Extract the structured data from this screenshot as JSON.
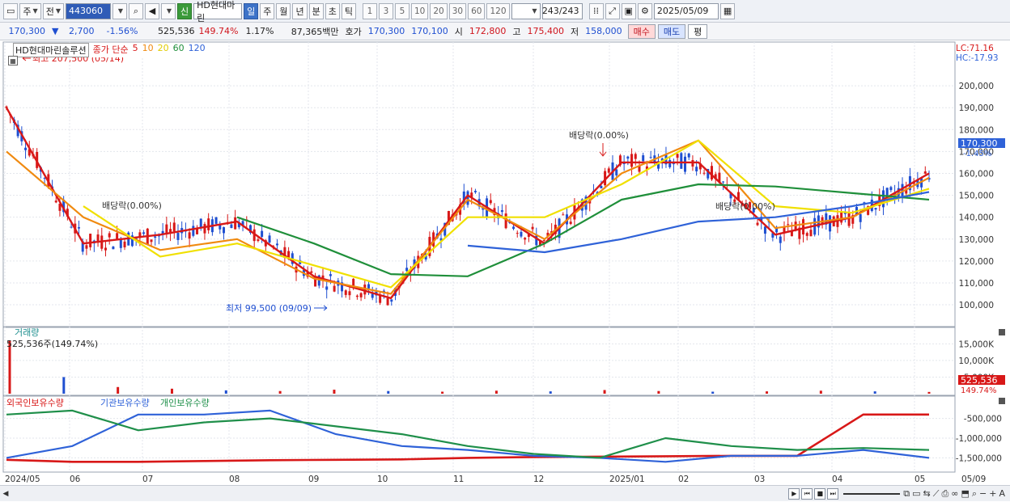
{
  "toolbar": {
    "period_label": "주",
    "prev_label": "전",
    "code": "443060",
    "new_badge": "신",
    "name": "HD현대마린",
    "intervals": [
      "일",
      "주",
      "월",
      "년",
      "분",
      "초",
      "틱"
    ],
    "active_interval": "일",
    "multipliers": [
      "1",
      "3",
      "5",
      "10",
      "20",
      "30",
      "60",
      "120"
    ],
    "count": "243",
    "count_total": "/243",
    "date": "2025/05/09"
  },
  "pricebar": {
    "price": "170,300",
    "change_arrow": "▼",
    "change": "2,700",
    "change_pct": "-1.56%",
    "volume": "525,536",
    "volume_ratio": "149.74%",
    "turnover": "1.17%",
    "amount": "87,365백만",
    "ask_label": "호가",
    "ask": "170,300",
    "bid": "170,100",
    "open_label": "시",
    "open": "172,800",
    "high_label": "고",
    "high": "175,400",
    "low_label": "저",
    "low": "158,000",
    "buy_button": "매수",
    "sell_button": "매도",
    "eval_button": "평"
  },
  "price_panel": {
    "title": "HD현대마린솔루션",
    "ma_label": "종가 단순",
    "ma_periods": [
      {
        "label": "5",
        "color": "#d81818"
      },
      {
        "label": "10",
        "color": "#f08a10"
      },
      {
        "label": "20",
        "color": "#f0e000"
      },
      {
        "label": "60",
        "color": "#1f8f3a"
      },
      {
        "label": "120",
        "color": "#2f62d8"
      }
    ],
    "lc_label": "LC:71.16",
    "hc_label": "HC:-17.93",
    "high_note": "최고 207,500 (05/14)",
    "low_note": "최저 99,500 (09/09)",
    "dividend_notes": [
      "배당락(0.00%)",
      "배당락(0.00%)",
      "배당락(0.00%)"
    ],
    "current_tag": "170,300",
    "current_pct": "-1.45%",
    "y_ticks": [
      "200,000",
      "190,000",
      "180,000",
      "170,000",
      "160,000",
      "150,000",
      "140,000",
      "130,000",
      "120,000",
      "110,000",
      "100,000"
    ]
  },
  "volume_panel": {
    "title": "거래량",
    "value_note": "525,536주(149.74%)",
    "y_ticks": [
      "15,000K",
      "10,000K",
      "5,000K"
    ],
    "current_tag": "525,536",
    "current_pct": "149.74%"
  },
  "holding_panel": {
    "series": [
      {
        "label": "외국인보유수량",
        "color": "#d81818"
      },
      {
        "label": "기관보유수량",
        "color": "#2f62d8"
      },
      {
        "label": "개인보유수량",
        "color": "#1f8f4a"
      }
    ],
    "y_ticks": [
      "-500,000",
      "-1,000,000",
      "-1,500,000"
    ]
  },
  "x_axis": {
    "labels": [
      "2024/05",
      "06",
      "07",
      "08",
      "09",
      "10",
      "11",
      "12",
      "2025/01",
      "02",
      "03",
      "04",
      "05"
    ],
    "end_label": "05/09"
  },
  "colors": {
    "up": "#d81818",
    "down": "#1f4fd1",
    "accent": "#3d73c8"
  },
  "chart_data": [
    {
      "type": "line",
      "title": "HD현대마린솔루션",
      "ylim": [
        93000,
        210000
      ],
      "x": [
        "2024/05",
        "06",
        "07",
        "08",
        "09",
        "10",
        "11",
        "12",
        "2025/01",
        "02",
        "03",
        "04",
        "05"
      ],
      "series": [
        {
          "name": "5",
          "values": [
            190000,
            128000,
            132000,
            138000,
            113000,
            103000,
            150000,
            128000,
            165000,
            165000,
            132000,
            140000,
            160000
          ]
        },
        {
          "name": "10",
          "values": [
            170000,
            140000,
            125000,
            130000,
            112000,
            105000,
            148000,
            130000,
            160000,
            175000,
            135000,
            140000,
            158000
          ]
        },
        {
          "name": "20",
          "values": [
            null,
            145000,
            122000,
            128000,
            118000,
            108000,
            140000,
            140000,
            155000,
            175000,
            145000,
            142000,
            153000
          ]
        },
        {
          "name": "60",
          "values": [
            null,
            null,
            null,
            140000,
            128000,
            114000,
            113000,
            128000,
            148000,
            155000,
            154000,
            151000,
            148000
          ]
        },
        {
          "name": "120",
          "values": [
            null,
            null,
            null,
            null,
            null,
            null,
            127000,
            124000,
            130000,
            138000,
            140000,
            145000,
            151500
          ]
        }
      ]
    },
    {
      "type": "bar",
      "title": "거래량",
      "ylim": [
        0,
        18000
      ],
      "values": [
        16000,
        5000,
        2000,
        1500,
        1000,
        800,
        1200,
        800,
        600,
        900,
        700,
        1100,
        800,
        600,
        700,
        900,
        700,
        525.536
      ]
    },
    {
      "type": "line",
      "ylim": [
        -1800000,
        -200000
      ],
      "series": [
        {
          "name": "외국인보유수량",
          "values": [
            -1550000,
            -1600000,
            -1600000,
            -1580000,
            -1560000,
            -1550000,
            -1540000,
            -1500000,
            -1480000,
            -1470000,
            -1460000,
            -1450000,
            -1450000,
            -400000,
            -400000
          ]
        },
        {
          "name": "기관보유수량",
          "values": [
            -1500000,
            -1200000,
            -400000,
            -400000,
            -300000,
            -900000,
            -1200000,
            -1300000,
            -1450000,
            -1500000,
            -1600000,
            -1450000,
            -1450000,
            -1300000,
            -1500000
          ]
        },
        {
          "name": "개인보유수량",
          "values": [
            -400000,
            -300000,
            -800000,
            -600000,
            -500000,
            -700000,
            -900000,
            -1200000,
            -1400000,
            -1500000,
            -1000000,
            -1200000,
            -1300000,
            -1250000,
            -1300000
          ]
        }
      ]
    }
  ]
}
